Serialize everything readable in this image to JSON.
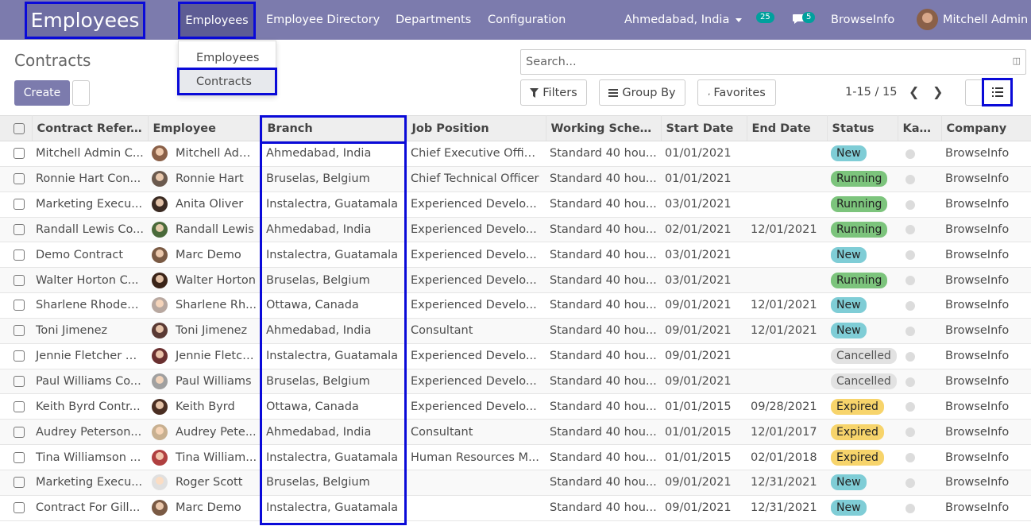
{
  "app": {
    "title": "Employees"
  },
  "nav": {
    "items": [
      "Employees",
      "Employee Directory",
      "Departments",
      "Configuration"
    ],
    "company": "Ahmedabad, India",
    "activity_count": "25",
    "message_count": "5",
    "company_name": "BrowseInfo",
    "user": "Mitchell Admin"
  },
  "dropdown": {
    "items": [
      "Employees",
      "Contracts"
    ]
  },
  "page": {
    "title": "Contracts",
    "create_label": "Create"
  },
  "search": {
    "placeholder": "Search..."
  },
  "controls": {
    "filters": "Filters",
    "group_by": "Group By",
    "favorites": "Favorites",
    "pager": "1-15 / 15"
  },
  "colors": {
    "nav_bg": "#7c7bad",
    "highlight": "#0a0ad8"
  },
  "table": {
    "headers": [
      "Contract Refer...",
      "Employee",
      "Branch",
      "Job Position",
      "Working Sched...",
      "Start Date",
      "End Date",
      "Status",
      "Kan...",
      "Company"
    ],
    "rows": [
      {
        "ref": "Mitchell Admin C...",
        "employee": "Mitchell Admin",
        "branch": "Ahmedabad, India",
        "job": "Chief Executive Officer",
        "schedule": "Standard 40 hou...",
        "start": "01/01/2021",
        "end": "",
        "status": "New",
        "company": "BrowseInfo",
        "avatar": "#8a6048"
      },
      {
        "ref": "Ronnie Hart Con...",
        "employee": "Ronnie Hart",
        "branch": "Bruselas, Belgium",
        "job": "Chief Technical Officer",
        "schedule": "Standard 40 hou...",
        "start": "01/01/2021",
        "end": "",
        "status": "Running",
        "company": "BrowseInfo",
        "avatar": "#6b5a4e"
      },
      {
        "ref": "Marketing Execu...",
        "employee": "Anita Oliver",
        "branch": "Instalectra, Guatamala",
        "job": "Experienced Develo...",
        "schedule": "Standard 40 hou...",
        "start": "03/01/2021",
        "end": "",
        "status": "Running",
        "company": "BrowseInfo",
        "avatar": "#3a2a22"
      },
      {
        "ref": "Randall Lewis Co...",
        "employee": "Randall Lewis",
        "branch": "Ahmedabad, India",
        "job": "Experienced Develo...",
        "schedule": "Standard 40 hou...",
        "start": "02/01/2021",
        "end": "12/01/2021",
        "status": "Running",
        "company": "BrowseInfo",
        "avatar": "#4a6a3a"
      },
      {
        "ref": "Demo Contract",
        "employee": "Marc Demo",
        "branch": "Instalectra, Guatamala",
        "job": "Experienced Develo...",
        "schedule": "Standard 40 hou...",
        "start": "03/01/2021",
        "end": "",
        "status": "New",
        "company": "BrowseInfo",
        "avatar": "#7a5a44"
      },
      {
        "ref": "Walter Horton C...",
        "employee": "Walter Horton",
        "branch": "Bruselas, Belgium",
        "job": "Experienced Develo...",
        "schedule": "Standard 40 hou...",
        "start": "03/01/2021",
        "end": "",
        "status": "Running",
        "company": "BrowseInfo",
        "avatar": "#3b2418"
      },
      {
        "ref": "Sharlene Rhodes...",
        "employee": "Sharlene Rh...",
        "branch": "Ottawa, Canada",
        "job": "Experienced Develo...",
        "schedule": "Standard 40 hou...",
        "start": "09/01/2021",
        "end": "12/01/2021",
        "status": "New",
        "company": "BrowseInfo",
        "avatar": "#b8a8a0"
      },
      {
        "ref": "Toni Jimenez",
        "employee": "Toni Jimenez",
        "branch": "Ahmedabad, India",
        "job": "Consultant",
        "schedule": "Standard 40 hou...",
        "start": "09/01/2021",
        "end": "12/01/2021",
        "status": "New",
        "company": "BrowseInfo",
        "avatar": "#5a3a34"
      },
      {
        "ref": "Jennie Fletcher C...",
        "employee": "Jennie Fletch...",
        "branch": "Instalectra, Guatamala",
        "job": "Experienced Develo...",
        "schedule": "Standard 40 hou...",
        "start": "09/01/2021",
        "end": "",
        "status": "Cancelled",
        "company": "BrowseInfo",
        "avatar": "#6a3030"
      },
      {
        "ref": "Paul Williams Co...",
        "employee": "Paul Williams",
        "branch": "Bruselas, Belgium",
        "job": "Experienced Develo...",
        "schedule": "Standard 40 hou...",
        "start": "09/01/2021",
        "end": "",
        "status": "Cancelled",
        "company": "BrowseInfo",
        "avatar": "#a0a0a0"
      },
      {
        "ref": "Keith Byrd Contr...",
        "employee": "Keith Byrd",
        "branch": "Ottawa, Canada",
        "job": "Experienced Develo...",
        "schedule": "Standard 40 hou...",
        "start": "01/01/2015",
        "end": "09/28/2021",
        "status": "Expired",
        "company": "BrowseInfo",
        "avatar": "#4a2e22"
      },
      {
        "ref": "Audrey Peterson...",
        "employee": "Audrey Pete...",
        "branch": "Ahmedabad, India",
        "job": "Consultant",
        "schedule": "Standard 40 hou...",
        "start": "01/01/2015",
        "end": "12/01/2017",
        "status": "Expired",
        "company": "BrowseInfo",
        "avatar": "#c8b090"
      },
      {
        "ref": "Tina Williamson ...",
        "employee": "Tina William...",
        "branch": "Instalectra, Guatamala",
        "job": "Human Resources M...",
        "schedule": "Standard 40 hou...",
        "start": "01/01/2015",
        "end": "02/01/2018",
        "status": "Expired",
        "company": "BrowseInfo",
        "avatar": "#b04040"
      },
      {
        "ref": "Marketing Execu...",
        "employee": "Roger Scott",
        "branch": "Bruselas, Belgium",
        "job": "",
        "schedule": "Standard 40 hou...",
        "start": "09/01/2021",
        "end": "12/31/2021",
        "status": "New",
        "company": "BrowseInfo",
        "avatar": "#e0e0e0"
      },
      {
        "ref": "Contract For Gill...",
        "employee": "Marc Demo",
        "branch": "Instalectra, Guatamala",
        "job": "",
        "schedule": "Standard 40 hou...",
        "start": "09/01/2021",
        "end": "12/31/2021",
        "status": "New",
        "company": "BrowseInfo",
        "avatar": "#7a5a44"
      }
    ]
  }
}
